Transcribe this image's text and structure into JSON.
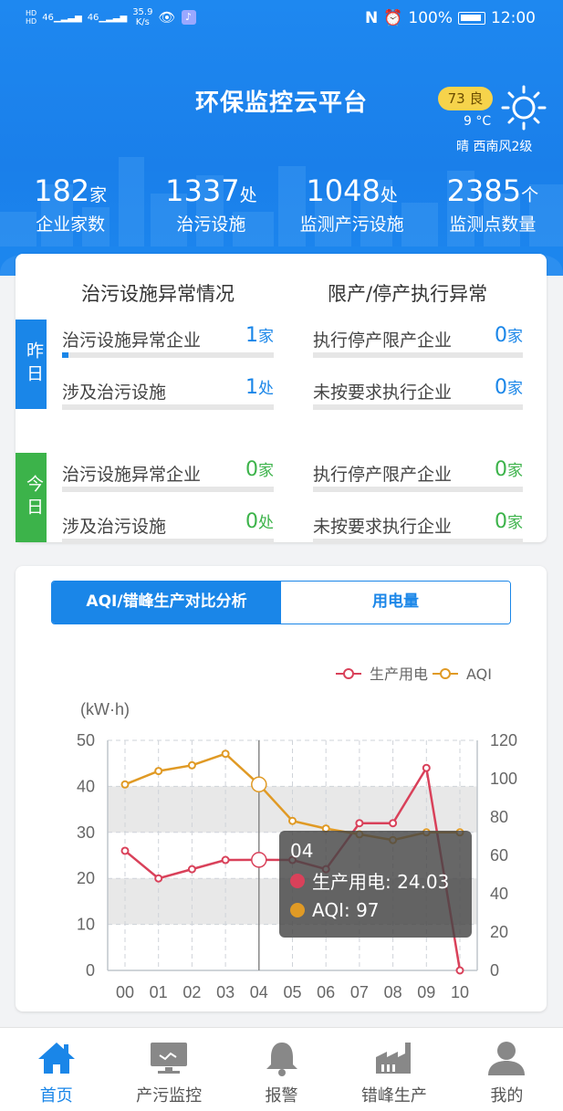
{
  "status_bar": {
    "net_top": "HD",
    "net_bottom": "HD",
    "sig1": "46",
    "sig2": "46",
    "speed_value": "35.9",
    "speed_unit": "K/s",
    "battery": "100%",
    "time": "12:00"
  },
  "header": {
    "title": "环保监控云平台",
    "aqi_badge": "73 良",
    "temperature": "9 °C",
    "weather": "晴 西南风2级"
  },
  "stats": [
    {
      "value": "182",
      "unit": "家",
      "label": "企业家数"
    },
    {
      "value": "1337",
      "unit": "处",
      "label": "治污设施"
    },
    {
      "value": "1048",
      "unit": "处",
      "label": "监测产污设施"
    },
    {
      "value": "2385",
      "unit": "个",
      "label": "监测点数量"
    }
  ],
  "abnormal": {
    "left_title": "治污设施异常情况",
    "right_title": "限产/停产执行异常",
    "yesterday_tag": "昨日",
    "today_tag": "今日",
    "yesterday": {
      "l1": {
        "label": "治污设施异常企业",
        "value": "1",
        "unit": "家",
        "fill": 0.01
      },
      "l2": {
        "label": "涉及治污设施",
        "value": "1",
        "unit": "处",
        "fill": 0
      },
      "r1": {
        "label": "执行停产限产企业",
        "value": "0",
        "unit": "家",
        "fill": 0
      },
      "r2": {
        "label": "未按要求执行企业",
        "value": "0",
        "unit": "家",
        "fill": 0
      }
    },
    "today": {
      "l1": {
        "label": "治污设施异常企业",
        "value": "0",
        "unit": "家",
        "fill": 0
      },
      "l2": {
        "label": "涉及治污设施",
        "value": "0",
        "unit": "处",
        "fill": 0
      },
      "r1": {
        "label": "执行停产限产企业",
        "value": "0",
        "unit": "家",
        "fill": 0
      },
      "r2": {
        "label": "未按要求执行企业",
        "value": "0",
        "unit": "家",
        "fill": 0
      }
    }
  },
  "tabs": {
    "active": "AQI/错峰生产对比分析",
    "inactive": "用电量"
  },
  "chart_data": {
    "type": "line",
    "categories": [
      "00",
      "01",
      "02",
      "03",
      "04",
      "05",
      "06",
      "07",
      "08",
      "09",
      "10"
    ],
    "series": [
      {
        "name": "生产用电",
        "axis": "left",
        "color": "#d9415a",
        "values": [
          26,
          20,
          22,
          24,
          24.03,
          24,
          22,
          32,
          32,
          44,
          0
        ]
      },
      {
        "name": "AQI",
        "axis": "right",
        "color": "#e09a25",
        "values": [
          97,
          104,
          107,
          113,
          97,
          78,
          74,
          71,
          68,
          72,
          72
        ]
      }
    ],
    "ylabel": "(kW·h)",
    "ylim_left": [
      0,
      50
    ],
    "yticks_left": [
      "0",
      "10",
      "20",
      "30",
      "40",
      "50"
    ],
    "ylim_right": [
      0,
      120
    ],
    "yticks_right": [
      "0",
      "20",
      "40",
      "60",
      "80",
      "100",
      "120"
    ],
    "legend_position": "top-right",
    "grid": true,
    "highlight_index": 4,
    "tooltip": {
      "title": "04",
      "lines": [
        {
          "name": "生产用电",
          "value": "24.03"
        },
        {
          "name": "AQI",
          "value": "97"
        }
      ]
    }
  },
  "tooltip_text": {
    "title": "04",
    "line1": "生产用电: 24.03",
    "line2": "AQI: 97"
  },
  "nav": [
    {
      "label": "首页",
      "icon": "home-icon",
      "active": true
    },
    {
      "label": "产污监控",
      "icon": "monitor-icon",
      "active": false
    },
    {
      "label": "报警",
      "icon": "bell-icon",
      "active": false
    },
    {
      "label": "错峰生产",
      "icon": "factory-icon",
      "active": false
    },
    {
      "label": "我的",
      "icon": "user-icon",
      "active": false
    }
  ],
  "colors": {
    "primary": "#1a86e8",
    "green": "#3cb34a",
    "power": "#d9415a",
    "aqi": "#e09a25"
  }
}
